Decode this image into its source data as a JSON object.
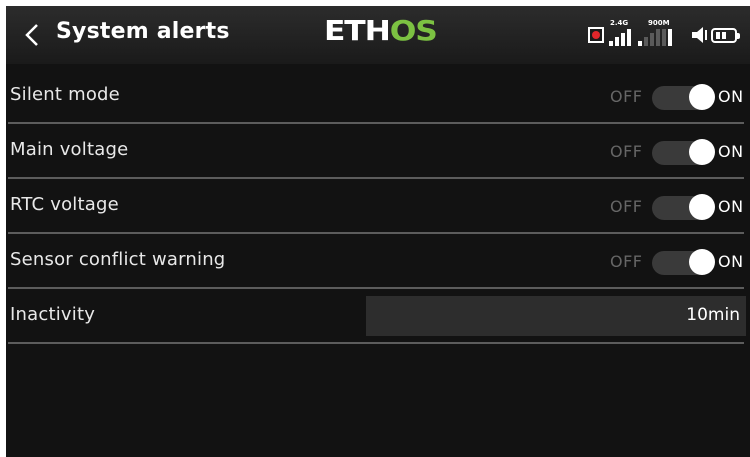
{
  "header": {
    "title": "System alerts",
    "logo_left": "ETH",
    "logo_right": "OS",
    "freq_label_1": "2.4G",
    "freq_label_2": "900M"
  },
  "rows": [
    {
      "label": "Silent mode",
      "off_label": "OFF",
      "on_label": "ON",
      "state": "on"
    },
    {
      "label": "Main voltage",
      "off_label": "OFF",
      "on_label": "ON",
      "state": "on"
    },
    {
      "label": "RTC voltage",
      "off_label": "OFF",
      "on_label": "ON",
      "state": "on"
    },
    {
      "label": "Sensor conflict warning",
      "off_label": "OFF",
      "on_label": "ON",
      "state": "on"
    }
  ],
  "inactivity": {
    "label": "Inactivity",
    "value": "10min"
  },
  "colors": {
    "accent": "#7cc242",
    "background": "#121212",
    "record": "#e0262b"
  },
  "icons": [
    "back-icon",
    "record-icon",
    "signal-2g4-icon",
    "signal-900m-icon",
    "speaker-icon",
    "battery-icon"
  ]
}
